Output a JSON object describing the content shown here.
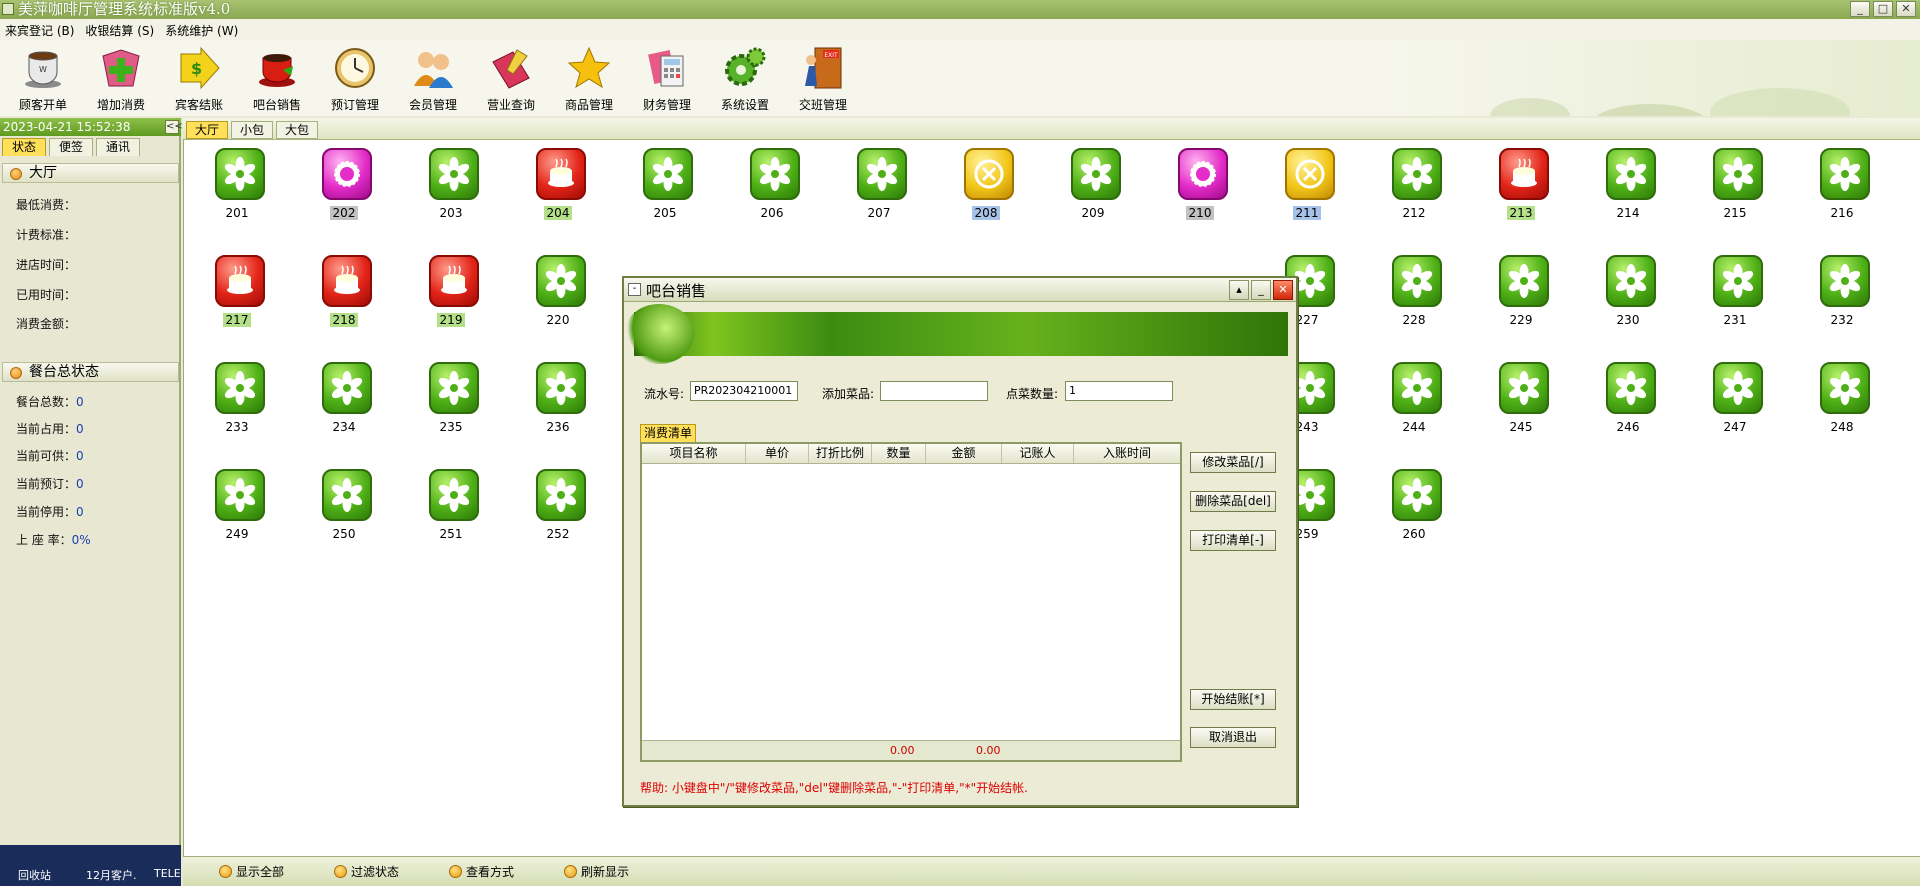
{
  "window": {
    "title": "美萍咖啡厅管理系统标准版v4.0"
  },
  "menu": [
    "来宾登记 (B)",
    "收银结算 (S)",
    "系统维护 (W)"
  ],
  "toolbar": [
    {
      "label": "顾客开单",
      "icon": "coffee-cup-icon"
    },
    {
      "label": "增加消费",
      "icon": "add-plus-icon"
    },
    {
      "label": "宾客结账",
      "icon": "dollar-arrow-icon"
    },
    {
      "label": "吧台销售",
      "icon": "bar-cup-icon"
    },
    {
      "label": "预订管理",
      "icon": "clock-icon"
    },
    {
      "label": "会员管理",
      "icon": "members-icon"
    },
    {
      "label": "营业查询",
      "icon": "search-book-icon"
    },
    {
      "label": "商品管理",
      "icon": "star-icon"
    },
    {
      "label": "财务管理",
      "icon": "calculator-icon"
    },
    {
      "label": "系统设置",
      "icon": "gear-icon"
    },
    {
      "label": "交班管理",
      "icon": "exit-door-icon"
    }
  ],
  "sidebar": {
    "datetime": "2023-04-21 15:52:38",
    "collapse_label": "<<",
    "tabs": [
      "状态",
      "便签",
      "通讯"
    ],
    "hall_section": "大厅",
    "hall_fields": [
      "最低消费：",
      "计费标准：",
      "进店时间：",
      "已用时间：",
      "消费金额："
    ],
    "summary_section": "餐台总状态",
    "summary": [
      {
        "label": "餐台总数：",
        "value": "0"
      },
      {
        "label": "当前占用：",
        "value": "0"
      },
      {
        "label": "当前可供：",
        "value": "0"
      },
      {
        "label": "当前预订：",
        "value": "0"
      },
      {
        "label": "当前停用：",
        "value": "0"
      },
      {
        "label": "上 座 率：",
        "value": "0%"
      }
    ],
    "desktop_icons": [
      "回收站",
      "12月客户.",
      "TELE"
    ]
  },
  "main_tabs": [
    "大厅",
    "小包",
    "大包"
  ],
  "rooms": [
    {
      "num": "201",
      "status": "free"
    },
    {
      "num": "202",
      "status": "pink",
      "hl": "gray"
    },
    {
      "num": "203",
      "status": "free"
    },
    {
      "num": "204",
      "status": "red",
      "hl": "green"
    },
    {
      "num": "205",
      "status": "free"
    },
    {
      "num": "206",
      "status": "free"
    },
    {
      "num": "207",
      "status": "free"
    },
    {
      "num": "208",
      "status": "stop",
      "hl": "blue"
    },
    {
      "num": "209",
      "status": "free"
    },
    {
      "num": "210",
      "status": "pink",
      "hl": "gray"
    },
    {
      "num": "211",
      "status": "stop",
      "hl": "blue"
    },
    {
      "num": "212",
      "status": "free"
    },
    {
      "num": "213",
      "status": "red",
      "hl": "green"
    },
    {
      "num": "214",
      "status": "free"
    },
    {
      "num": "215",
      "status": "free"
    },
    {
      "num": "216",
      "status": "free"
    },
    {
      "num": "217",
      "status": "red",
      "hl": "green"
    },
    {
      "num": "218",
      "status": "red",
      "hl": "green"
    },
    {
      "num": "219",
      "status": "red",
      "hl": "green"
    },
    {
      "num": "220",
      "status": "free"
    },
    {
      "num": "227",
      "status": "free"
    },
    {
      "num": "228",
      "status": "free"
    },
    {
      "num": "229",
      "status": "free"
    },
    {
      "num": "230",
      "status": "free"
    },
    {
      "num": "231",
      "status": "free"
    },
    {
      "num": "232",
      "status": "free"
    },
    {
      "num": "233",
      "status": "free"
    },
    {
      "num": "234",
      "status": "free"
    },
    {
      "num": "235",
      "status": "free"
    },
    {
      "num": "236",
      "status": "free"
    },
    {
      "num": "243",
      "status": "free"
    },
    {
      "num": "244",
      "status": "free"
    },
    {
      "num": "245",
      "status": "free"
    },
    {
      "num": "246",
      "status": "free"
    },
    {
      "num": "247",
      "status": "free"
    },
    {
      "num": "248",
      "status": "free"
    },
    {
      "num": "249",
      "status": "free"
    },
    {
      "num": "250",
      "status": "free"
    },
    {
      "num": "251",
      "status": "free"
    },
    {
      "num": "252",
      "status": "free"
    },
    {
      "num": "259",
      "status": "free"
    },
    {
      "num": "260",
      "status": "free"
    }
  ],
  "statusbar": [
    "显示全部",
    "过滤状态",
    "查看方式",
    "刷新显示"
  ],
  "dialog": {
    "title": "吧台销售",
    "serial_label": "流水号:",
    "serial_value": "PR202304210001",
    "add_item_label": "添加菜品:",
    "add_item_value": "",
    "qty_label": "点菜数量:",
    "qty_value": "1",
    "list_tab": "消费清单",
    "columns": [
      "项目名称",
      "单价",
      "打折比例",
      "数量",
      "金额",
      "记账人",
      "入账时间"
    ],
    "totals": [
      "0.00",
      "0.00"
    ],
    "buttons": [
      "修改菜品[/]",
      "删除菜品[del]",
      "打印清单[-]",
      "开始结账[*]",
      "取消退出"
    ],
    "help": "帮助: 小键盘中\"/\"键修改菜品,\"del\"键删除菜品,\"-\"打印清单,\"*\"开始结帐."
  },
  "colors": {
    "accent_green": "#5e9a20",
    "tab_active": "#ffe05a",
    "help_red": "#d00000"
  }
}
